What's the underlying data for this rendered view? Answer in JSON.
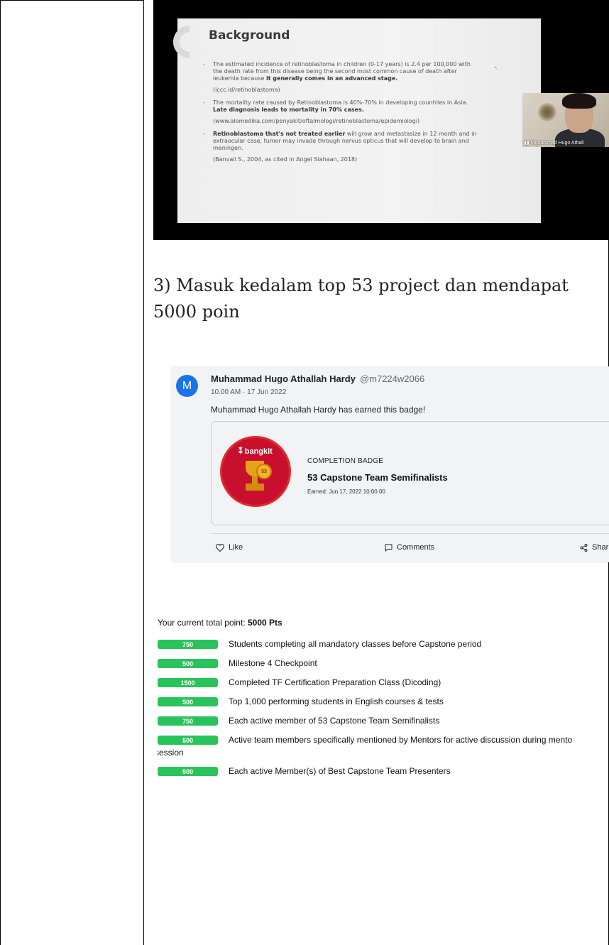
{
  "slide": {
    "title": "Background",
    "items": [
      {
        "pre": "The estimated incidence of retinoblastoma in children (0-17 years) is 2.4 per 100,000 with the death rate from this disease being the second most common cause of death after leukemia because ",
        "bold": "it generally comes in an advanced stage.",
        "cite": "(iccc.id/retinoblastoma)"
      },
      {
        "pre": "The mortality rate caused by Retinoblastoma is 40%-70% in developing countries in Asia. ",
        "bold": "Late diagnosis leads to mortality in 70% cases.",
        "cite": "(www.alomedika.com/penyakit/oftalmologi/retinoblastoma/epidemiologi)"
      },
      {
        "bold": "Retinoblastoma that's not treated earlier",
        "post": " will grow and metastasize in 12 month and in extraocular case, tumor may invade through nervus opticus that will develop to brain and meningen.",
        "cite": "(Banvali S., 2004, as cited in Angel Siahaan, 2018)"
      }
    ],
    "participant_name": "Muhammad Hugo Athall"
  },
  "heading": "3) Masuk kedalam top 53 project dan mendapat 5000 poin",
  "card": {
    "avatar_letter": "M",
    "author": "Muhammad Hugo Athallah Hardy",
    "handle": "@m7224w2066",
    "time": "10.00 AM · 17 Jun 2022",
    "earned_text": "Muhammad Hugo Athallah Hardy has earned this badge!",
    "badge_brand": "bangkit",
    "badge_number": "53",
    "badge_type": "COMPLETION BADGE",
    "badge_name": "53 Capstone Team Semifinalists",
    "badge_earned": "Earned: Jun 17, 2022 10:00:00",
    "like_label": "Like",
    "comments_label": "Comments",
    "share_label": "Shar"
  },
  "points": {
    "total_label": "Your current total point:",
    "total_value": "5000 Pts",
    "rows": [
      {
        "value": "750",
        "label": "Students completing all mandatory classes before Capstone period"
      },
      {
        "value": "500",
        "label": "Milestone 4 Checkpoint"
      },
      {
        "value": "1500",
        "label": "Completed TF Certification Preparation Class (Dicoding)"
      },
      {
        "value": "500",
        "label": "Top 1,000 performing students in English courses & tests"
      },
      {
        "value": "750",
        "label": "Each active member of 53 Capstone Team Semifinalists"
      },
      {
        "value": "500",
        "label": "Active team members specifically mentioned by Mentors for active discussion during mento",
        "tail": "session"
      },
      {
        "value": "500",
        "label": "Each active Member(s) of Best Capstone Team Presenters"
      }
    ]
  },
  "colors": {
    "pill": "#29c35c",
    "avatar": "#1a73e8",
    "badge": "#c8102e"
  }
}
